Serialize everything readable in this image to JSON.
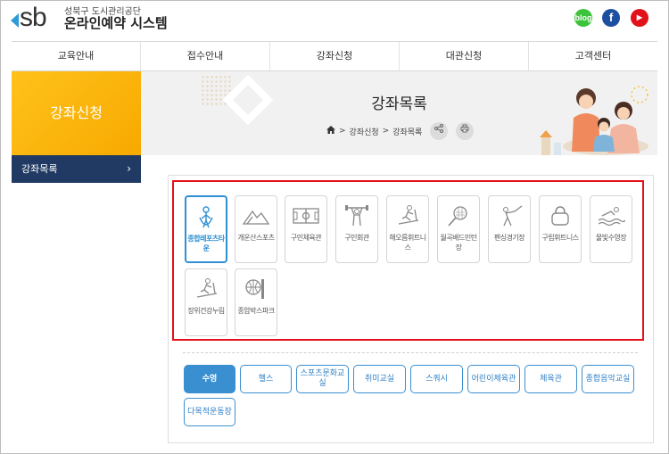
{
  "header": {
    "logo_sub": "성북구 도시관리공단",
    "logo_main": "온라인예약 시스템",
    "logo_letters": "sb",
    "social": [
      {
        "name": "blog",
        "label": "blog",
        "color": "#3cc33c"
      },
      {
        "name": "facebook",
        "label": "f",
        "color": "#1d4fa0"
      },
      {
        "name": "youtube",
        "label": "▶",
        "color": "#e1121a"
      }
    ]
  },
  "nav": [
    "교육안내",
    "접수안내",
    "강좌신청",
    "대관신청",
    "고객센터"
  ],
  "sidebar": {
    "title": "강좌신청",
    "items": [
      {
        "label": "강좌목록",
        "arrow": "›"
      }
    ]
  },
  "banner": {
    "title": "강좌목록",
    "breadcrumb": [
      "강좌신청",
      "강좌목록"
    ],
    "separator": ">"
  },
  "facilities": [
    {
      "label": "종합레포츠타운",
      "icon": "jump-rope-icon",
      "active": true
    },
    {
      "label": "개운산스포츠",
      "icon": "mountain-icon",
      "active": false
    },
    {
      "label": "구민체육관",
      "icon": "court-icon",
      "active": false
    },
    {
      "label": "구민회관",
      "icon": "weightlifter-icon",
      "active": false
    },
    {
      "label": "해오름휘트니스",
      "icon": "treadmill-icon",
      "active": false
    },
    {
      "label": "월곡배드민턴장",
      "icon": "badminton-icon",
      "active": false
    },
    {
      "label": "펜싱경기장",
      "icon": "fencing-icon",
      "active": false
    },
    {
      "label": "구립휘트니스",
      "icon": "kettlebell-icon",
      "active": false
    },
    {
      "label": "물빛수영장",
      "icon": "swimmer-icon",
      "active": false
    },
    {
      "label": "장위건강누림",
      "icon": "runner-icon",
      "active": false
    },
    {
      "label": "종암박스파크",
      "icon": "basketball-icon",
      "active": false
    }
  ],
  "categories": [
    {
      "label": "수영",
      "active": true
    },
    {
      "label": "헬스",
      "active": false
    },
    {
      "label": "스포츠문화교실",
      "active": false
    },
    {
      "label": "취미교실",
      "active": false
    },
    {
      "label": "스쿼시",
      "active": false
    },
    {
      "label": "어린이체육관",
      "active": false
    },
    {
      "label": "체육관",
      "active": false
    },
    {
      "label": "종합음악교실",
      "active": false
    },
    {
      "label": "다목적운동장",
      "active": false
    }
  ],
  "colors": {
    "accent": "#2f8fd3",
    "highlight": "#e4101a",
    "sidebar": "#213a63",
    "side_title": "#ffc21a"
  }
}
